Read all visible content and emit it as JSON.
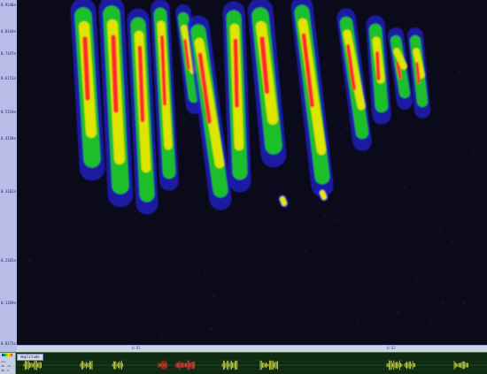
{
  "frequency_axis": {
    "ticks": [
      "0.9140e",
      "0.8144e",
      "0.7147e",
      "0.6151e",
      "0.5154e",
      "0.4158e",
      "0.3162e",
      "0.2165e",
      "0.1169e",
      "0.0172e"
    ]
  },
  "time_axis": {
    "labels": [
      "0:01",
      "0:02"
    ]
  },
  "amplitude": {
    "tab_label": "Amplitude",
    "side_labels": [
      "env",
      "dB -13",
      "dB -5"
    ]
  },
  "colors": {
    "background": "#0a0a1a",
    "low": "#1f1fd0",
    "mid": "#1fd21f",
    "high": "#e8e800",
    "peak": "#ff2a2a",
    "waveform": "#d7e04a",
    "selection_marker": "#ff3a3a"
  },
  "icons": {
    "palette_swatch": "color-scale-icon"
  }
}
